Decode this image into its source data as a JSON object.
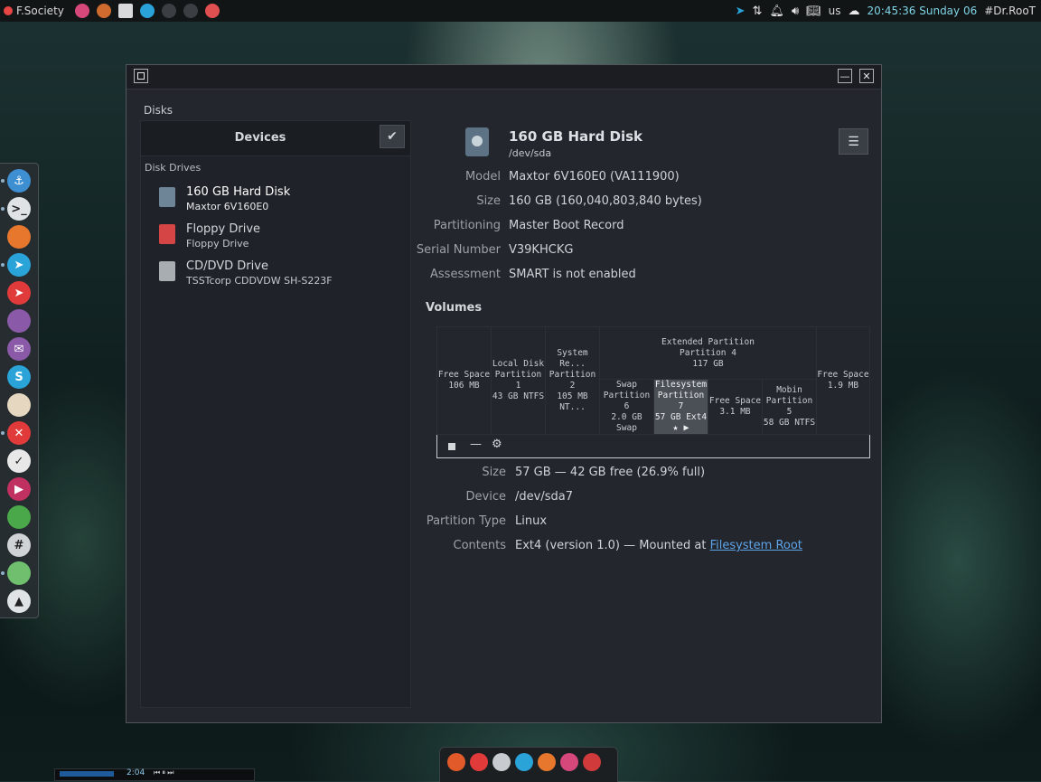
{
  "top_panel": {
    "brand": "F.Society",
    "apps": [
      {
        "icon": "browser-icon",
        "color": "#d6487a"
      },
      {
        "icon": "firefox-icon",
        "color": "#cf6b2e"
      },
      {
        "icon": "window-icon",
        "color": "#d8dadb"
      },
      {
        "icon": "telegram-icon",
        "color": "#2aa3d9"
      },
      {
        "icon": "terminal-icon",
        "color": "#3b3f44"
      },
      {
        "icon": "terminal-icon",
        "color": "#3b3f44"
      },
      {
        "icon": "plus-icon",
        "color": "#e05050"
      }
    ],
    "keyboard_layout": "us",
    "clock": "20:45:36  Sunday 06",
    "user": "#Dr.RooT"
  },
  "dock": [
    {
      "icon": "anchor-icon",
      "color": "#3d8fd1",
      "glyph": "⚓"
    },
    {
      "icon": "terminal-icon",
      "color": "#dfe3e6",
      "glyph": ">_"
    },
    {
      "icon": "firefox-icon",
      "color": "#e8772e",
      "glyph": ""
    },
    {
      "icon": "telegram-icon",
      "color": "#2aa3d9",
      "glyph": "➤"
    },
    {
      "icon": "telegram-red-icon",
      "color": "#e03a3a",
      "glyph": "➤"
    },
    {
      "icon": "pidgin-icon",
      "color": "#8a5aa8",
      "glyph": ""
    },
    {
      "icon": "mail-icon",
      "color": "#8a5aa8",
      "glyph": "✉"
    },
    {
      "icon": "skype-icon",
      "color": "#2aa3d9",
      "glyph": "S"
    },
    {
      "icon": "inkscape-icon",
      "color": "#e6d8c0",
      "glyph": ""
    },
    {
      "icon": "close-app-icon",
      "color": "#e03a3a",
      "glyph": "✕"
    },
    {
      "icon": "tasks-icon",
      "color": "#e8e8e8",
      "glyph": "✓"
    },
    {
      "icon": "media-player-icon",
      "color": "#c03060",
      "glyph": "▶"
    },
    {
      "icon": "puzzle-icon",
      "color": "#4aa84a",
      "glyph": ""
    },
    {
      "icon": "hash-icon",
      "color": "#d0d3d6",
      "glyph": "#"
    },
    {
      "icon": "toggle-icon",
      "color": "#6fbf6f",
      "glyph": ""
    },
    {
      "icon": "drive-icon",
      "color": "#dfe3e6",
      "glyph": "▲"
    }
  ],
  "window": {
    "app_label": "Disks",
    "sidebar": {
      "title": "Devices",
      "section": "Disk Drives",
      "drives": [
        {
          "name": "160 GB Hard Disk",
          "sub": "Maxtor 6V160E0",
          "icon": "hard-disk-icon",
          "color": "#6e8597"
        },
        {
          "name": "Floppy Drive",
          "sub": "Floppy Drive",
          "icon": "floppy-icon",
          "color": "#d64545"
        },
        {
          "name": "CD/DVD Drive",
          "sub": "TSSTcorp CDDVDW SH-S223F",
          "icon": "optical-drive-icon",
          "color": "#a8adb2"
        }
      ]
    },
    "disk": {
      "title": "160 GB Hard Disk",
      "device": "/dev/sda",
      "properties": [
        {
          "label": "Model",
          "value": "Maxtor 6V160E0 (VA111900)"
        },
        {
          "label": "Size",
          "value": "160 GB (160,040,803,840 bytes)"
        },
        {
          "label": "Partitioning",
          "value": "Master Boot Record"
        },
        {
          "label": "Serial Number",
          "value": "V39KHCKG"
        },
        {
          "label": "Assessment",
          "value": "SMART is not enabled"
        }
      ]
    },
    "volumes_heading": "Volumes",
    "volume_map": {
      "top": [
        {
          "lines": [
            "Free Space",
            "106 MB"
          ]
        },
        {
          "lines": [
            "Local Disk",
            "Partition 1",
            "43 GB NTFS"
          ]
        },
        {
          "lines": [
            "System Re...",
            "Partition 2",
            "105 MB NT..."
          ]
        },
        {
          "lines": [
            "Extended Partition",
            "Partition 4",
            "117 GB"
          ]
        },
        {
          "lines": [
            "Free Space",
            "1.9 MB"
          ]
        }
      ],
      "logical": [
        {
          "lines": [
            "Swap",
            "Partition 6",
            "2.0 GB Swap"
          ]
        },
        {
          "lines": [
            "Filesystem",
            "Partition 7",
            "57 GB Ext4"
          ],
          "selected": true
        },
        {
          "lines": [
            "Free Space",
            "3.1 MB"
          ]
        },
        {
          "lines": [
            "Mobin",
            "Partition 5",
            "58 GB NTFS"
          ]
        }
      ]
    },
    "volume_details": [
      {
        "label": "Size",
        "value": "57 GB — 42 GB free (26.9% full)"
      },
      {
        "label": "Device",
        "value": "/dev/sda7"
      },
      {
        "label": "Partition Type",
        "value": "Linux"
      },
      {
        "label": "Contents",
        "value": "Ext4 (version 1.0) — Mounted at ",
        "link": "Filesystem Root"
      }
    ]
  },
  "bottom_dock": [
    {
      "icon": "ubuntu-icon",
      "color": "#e05a2a"
    },
    {
      "icon": "opera-icon",
      "color": "#e03a3a"
    },
    {
      "icon": "settings-icon",
      "color": "#c8ccd0"
    },
    {
      "icon": "skype-icon",
      "color": "#2aa3d9"
    },
    {
      "icon": "firefox-icon",
      "color": "#e8772e"
    },
    {
      "icon": "browser-icon",
      "color": "#d6487a"
    },
    {
      "icon": "dictionary-icon",
      "color": "#d03a3a"
    }
  ],
  "player": {
    "time": "2:04"
  }
}
